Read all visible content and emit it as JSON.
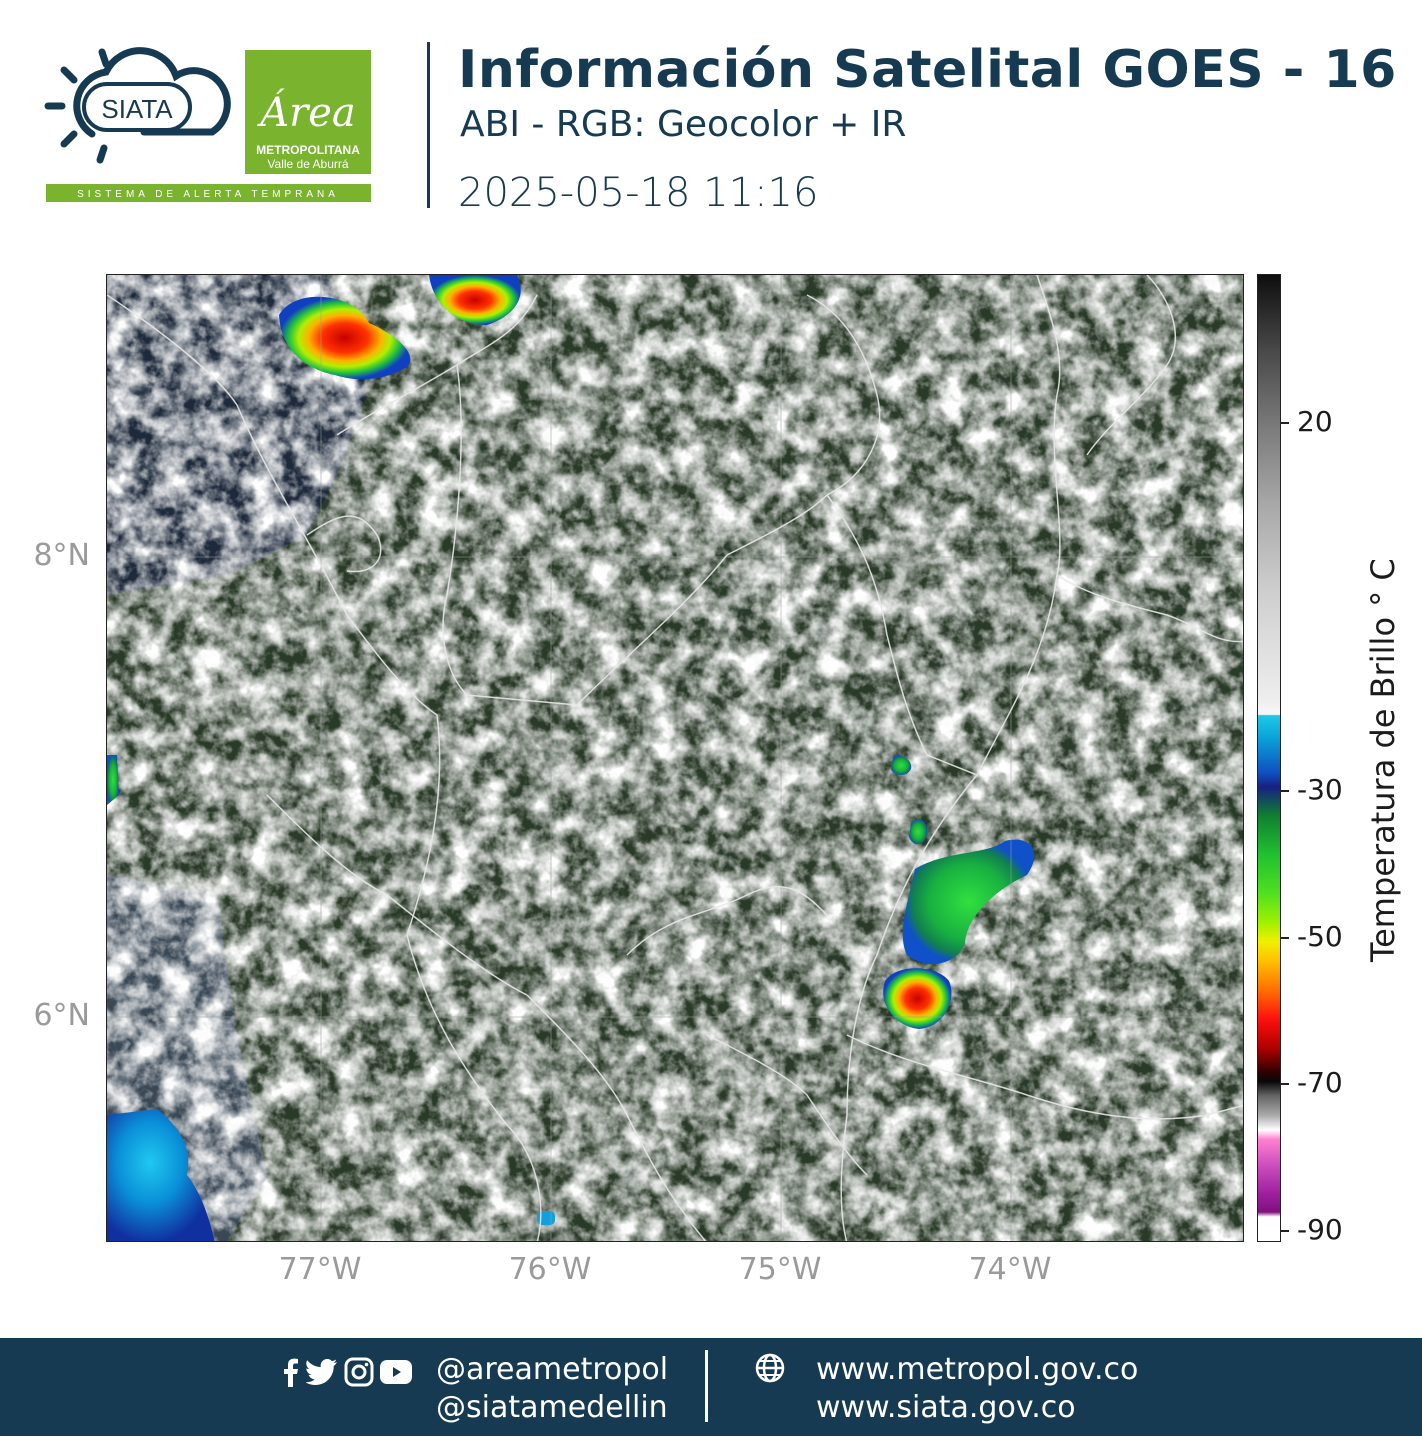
{
  "header": {
    "logo_siata_text": "SIATA",
    "logo_siata_tagline": "SISTEMA DE ALERTA TEMPRANA",
    "logo_area_script": "Área",
    "logo_area_line1": "METROPOLITANA",
    "logo_area_line2": "Valle de Aburrá",
    "title": "Información Satelital GOES - 16",
    "subtitle": "ABI - RGB: Geocolor + IR",
    "timestamp": "2025-05-18 11:16"
  },
  "map": {
    "x_ticks": [
      "77°W",
      "76°W",
      "75°W",
      "74°W"
    ],
    "y_ticks": [
      "8°N",
      "6°N"
    ],
    "colorbar": {
      "title": "Temperatura de Brillo  ° C",
      "ticks": [
        "20",
        "-30",
        "-50",
        "-70",
        "-90"
      ]
    }
  },
  "footer": {
    "social_icons": [
      "facebook-icon",
      "twitter-icon",
      "instagram-icon",
      "youtube-icon"
    ],
    "handle_1": "@areametropol",
    "handle_2": "@siatamedellin",
    "url_1": "www.metropol.gov.co",
    "url_2": "www.siata.gov.co"
  },
  "colors": {
    "brand_navy": "#163a52",
    "brand_green": "#7ab32e",
    "axis_gray": "#9a9a9a"
  }
}
